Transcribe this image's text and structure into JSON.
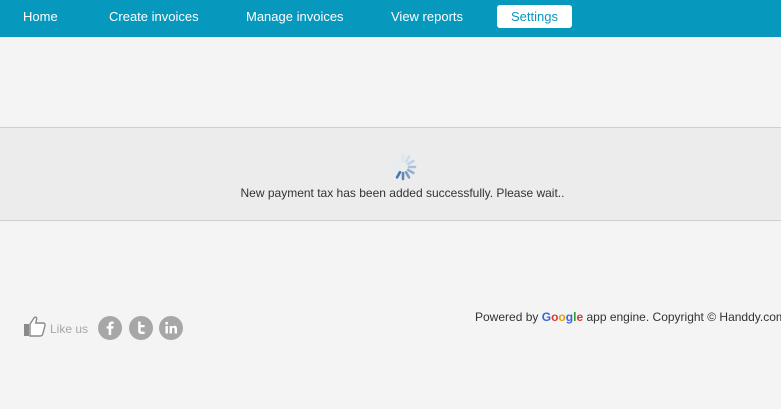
{
  "nav": {
    "items": [
      {
        "label": "Home"
      },
      {
        "label": "Create invoices"
      },
      {
        "label": "Manage invoices"
      },
      {
        "label": "View reports"
      },
      {
        "label": "Settings",
        "active": true
      }
    ],
    "bar_color": "#0799bd"
  },
  "notice": {
    "message": "New payment tax has been added successfully. Please wait.."
  },
  "footer": {
    "like_label": "Like us",
    "social": [
      {
        "name": "facebook-icon"
      },
      {
        "name": "twitter-icon"
      },
      {
        "name": "linkedin-icon"
      }
    ],
    "powered_prefix": "Powered by",
    "google_letters": [
      "G",
      "o",
      "o",
      "g",
      "l",
      "e"
    ],
    "powered_suffix": "app engine. Copyright",
    "copyright_symbol": "©",
    "company": "Handdy.com"
  }
}
